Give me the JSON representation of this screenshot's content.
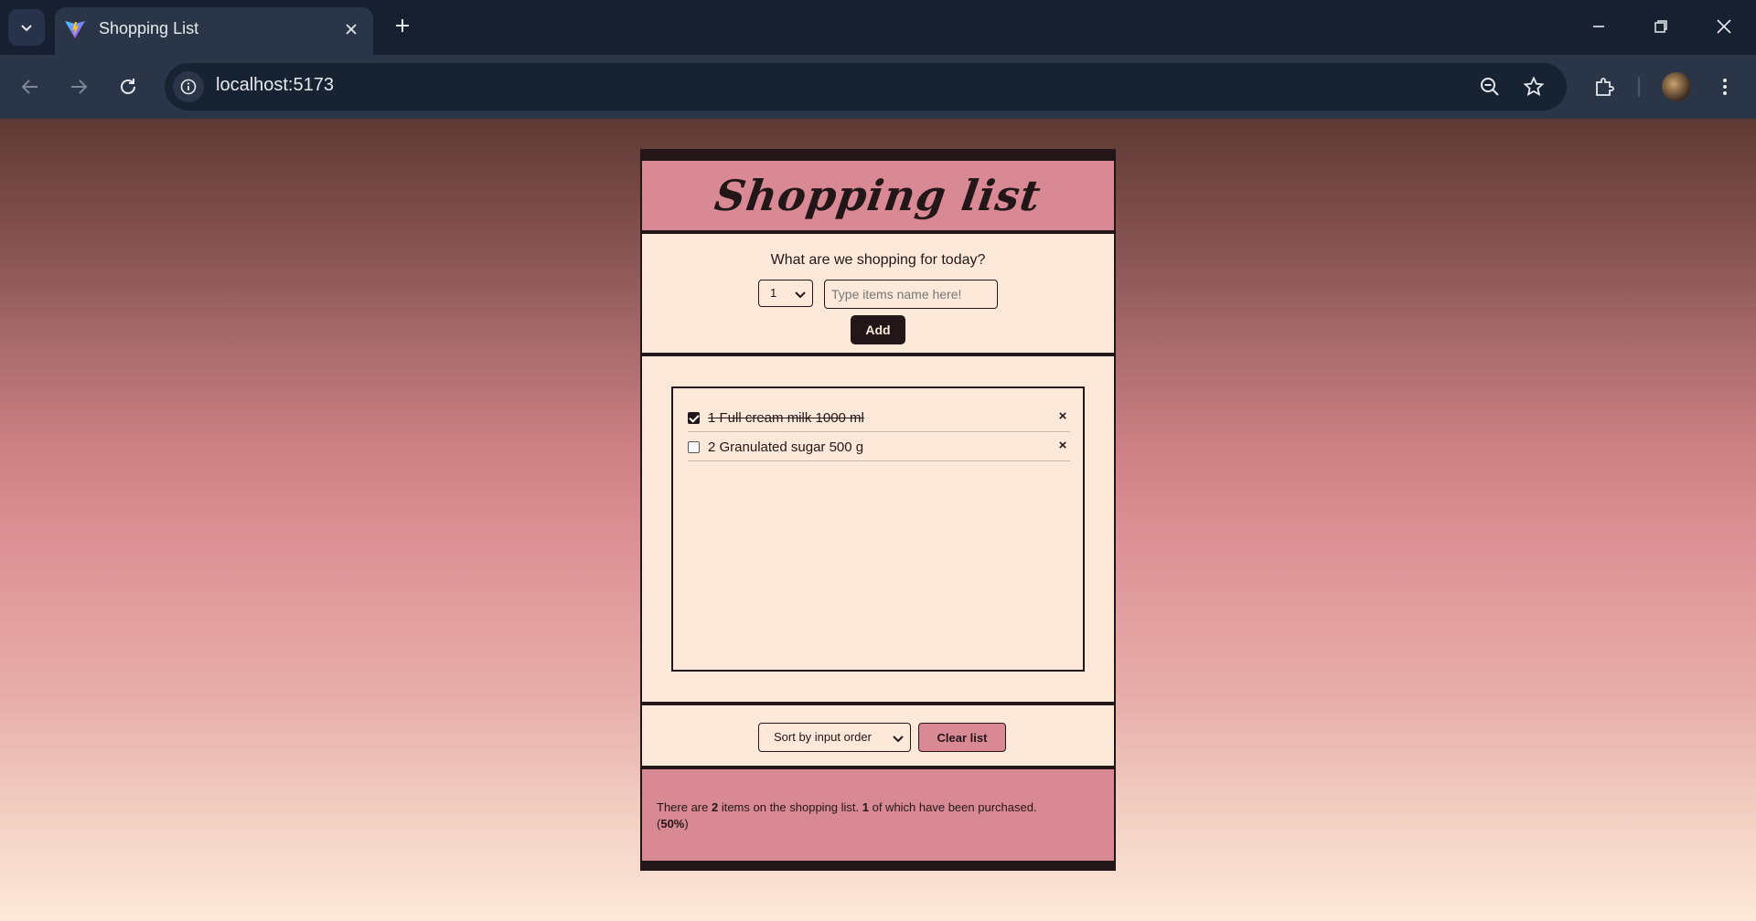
{
  "browser": {
    "tab_title": "Shopping List",
    "url": "localhost:5173"
  },
  "app": {
    "title": "Shopping list",
    "prompt": "What are we shopping for today?",
    "quantity_value": "1",
    "item_placeholder": "Type items name here!",
    "add_label": "Add",
    "items": [
      {
        "text": "1 Full cream milk 1000 ml",
        "checked": true,
        "remove": "×"
      },
      {
        "text": "2 Granulated sugar 500 g",
        "checked": false,
        "remove": "×"
      }
    ],
    "sort_value": "Sort by input order",
    "clear_label": "Clear list",
    "stats": {
      "pre": "There are ",
      "total": "2",
      "mid": " items on the shopping list. ",
      "purchased": "1",
      "post": " of which have been purchased.",
      "open": "(",
      "percent": "50%",
      "close": ")"
    }
  },
  "colors": {
    "accent_pink": "#d98993",
    "panel_cream": "#fde9d9",
    "ink_dark": "#231618"
  }
}
